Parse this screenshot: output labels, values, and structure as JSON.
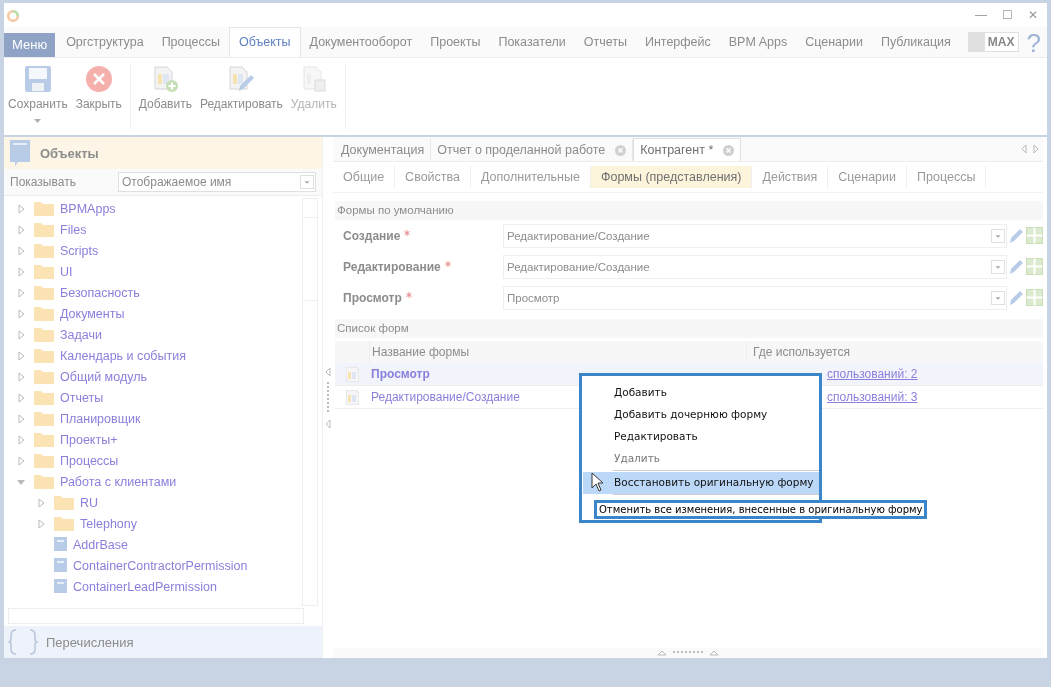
{
  "window": {
    "title_buttons": [
      "—",
      "☐",
      "✕"
    ]
  },
  "menu_button": "Меню",
  "main_tabs": [
    {
      "label": "Оргструктура",
      "selected": false
    },
    {
      "label": "Процессы",
      "selected": false
    },
    {
      "label": "Объекты",
      "selected": true
    },
    {
      "label": "Документооборот",
      "selected": false
    },
    {
      "label": "Проекты",
      "selected": false
    },
    {
      "label": "Показатели",
      "selected": false
    },
    {
      "label": "Отчеты",
      "selected": false
    },
    {
      "label": "Интерфейс",
      "selected": false
    },
    {
      "label": "BPM Apps",
      "selected": false
    },
    {
      "label": "Сценарии",
      "selected": false
    },
    {
      "label": "Публикация",
      "selected": false
    }
  ],
  "max_toggle": "MAX",
  "help": "?",
  "ribbon": [
    {
      "buttons": [
        {
          "label": "Сохранить",
          "kind": "save",
          "disabled": false,
          "dropdown": true
        },
        {
          "label": "Закрыть",
          "kind": "close",
          "disabled": false,
          "dropdown": false
        }
      ]
    },
    {
      "buttons": [
        {
          "label": "Добавить",
          "kind": "add",
          "disabled": false,
          "dropdown": false
        },
        {
          "label": "Редактировать",
          "kind": "edit",
          "disabled": false,
          "dropdown": false
        },
        {
          "label": "Удалить",
          "kind": "delete",
          "disabled": true,
          "dropdown": false
        }
      ]
    }
  ],
  "sidebar": {
    "title": "Объекты",
    "show_label": "Показывать",
    "show_value": "Отображаемое имя",
    "tree": [
      {
        "label": "BPMApps",
        "kind": "folder",
        "expanded": false
      },
      {
        "label": "Files",
        "kind": "folder",
        "expanded": false
      },
      {
        "label": "Scripts",
        "kind": "folder",
        "expanded": false
      },
      {
        "label": "UI",
        "kind": "folder",
        "expanded": false
      },
      {
        "label": "Безопасность",
        "kind": "folder",
        "expanded": false
      },
      {
        "label": "Документы",
        "kind": "folder",
        "expanded": false
      },
      {
        "label": "Задачи",
        "kind": "folder",
        "expanded": false
      },
      {
        "label": "Календарь и события",
        "kind": "folder",
        "expanded": false
      },
      {
        "label": "Общий модуль",
        "kind": "folder",
        "expanded": false
      },
      {
        "label": "Отчеты",
        "kind": "folder",
        "expanded": false
      },
      {
        "label": "Планировщик",
        "kind": "folder",
        "expanded": false
      },
      {
        "label": "Проекты+",
        "kind": "folder",
        "expanded": false
      },
      {
        "label": "Процессы",
        "kind": "folder",
        "expanded": false
      },
      {
        "label": "Работа с клиентами",
        "kind": "folder",
        "expanded": true,
        "children": [
          {
            "label": "RU",
            "kind": "folder",
            "expanded": false
          },
          {
            "label": "Telephony",
            "kind": "folder",
            "expanded": false
          },
          {
            "label": "AddrBase",
            "kind": "object"
          },
          {
            "label": "ContainerContractorPermission",
            "kind": "object"
          },
          {
            "label": "ContainerLeadPermission",
            "kind": "object"
          }
        ]
      }
    ],
    "footer": "Перечисления"
  },
  "doc_tabs": [
    {
      "label": "Документация",
      "closable": false,
      "selected": false
    },
    {
      "label": "Отчет о проделанной работе",
      "closable": true,
      "selected": false
    },
    {
      "label": "Контрагент *",
      "closable": true,
      "selected": true
    }
  ],
  "sub_tabs": [
    {
      "label": "Общие",
      "selected": false
    },
    {
      "label": "Свойства",
      "selected": false
    },
    {
      "label": "Дополнительные",
      "selected": false
    },
    {
      "label": "Формы (представления)",
      "selected": true
    },
    {
      "label": "Действия",
      "selected": false
    },
    {
      "label": "Сценарии",
      "selected": false
    },
    {
      "label": "Процессы",
      "selected": false
    }
  ],
  "default_forms": {
    "title": "Формы по умолчанию",
    "fields": [
      {
        "label": "Создание",
        "required": true,
        "value": "Редактирование/Создание"
      },
      {
        "label": "Редактирование",
        "required": true,
        "value": "Редактирование/Создание"
      },
      {
        "label": "Просмотр",
        "required": true,
        "value": "Просмотр"
      }
    ]
  },
  "form_list": {
    "title": "Список форм",
    "columns": [
      "Название формы",
      "Где используется"
    ],
    "rows": [
      {
        "name": "Просмотр",
        "usage": "спользований: 2",
        "selected": true
      },
      {
        "name": "Редактирование/Создание",
        "usage": "спользований: 3",
        "selected": false
      }
    ]
  },
  "context_menu": [
    {
      "kind": "item",
      "label": "Добавить",
      "disabled": false,
      "selected": false
    },
    {
      "kind": "item",
      "label": "Добавить дочернюю форму",
      "disabled": false,
      "selected": false
    },
    {
      "kind": "item",
      "label": "Редактировать",
      "disabled": false,
      "selected": false
    },
    {
      "kind": "item",
      "label": "Удалить",
      "disabled": true,
      "selected": false
    },
    {
      "kind": "separator"
    },
    {
      "kind": "item",
      "label": "Восстановить оригинальную форму",
      "disabled": false,
      "selected": true
    },
    {
      "kind": "separator"
    }
  ],
  "tooltip": "Отменить все изменения, внесенные в оригинальную форму"
}
